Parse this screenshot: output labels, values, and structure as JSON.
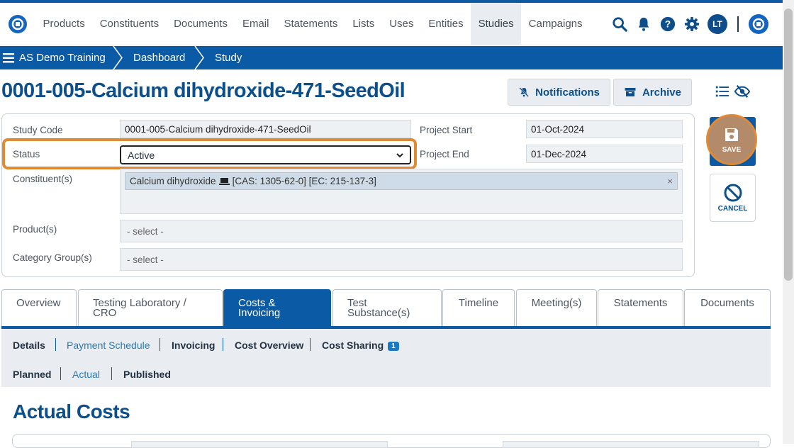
{
  "nav": {
    "items": [
      "Products",
      "Constituents",
      "Documents",
      "Email",
      "Statements",
      "Lists",
      "Uses",
      "Entities",
      "Studies",
      "Campaigns"
    ],
    "active": "Studies",
    "avatar_initials": "LT"
  },
  "breadcrumb": [
    "AS Demo Training",
    "Dashboard",
    "Study"
  ],
  "page_title": "0001-005-Calcium dihydroxide-471-SeedOil",
  "header_buttons": {
    "notifications": "Notifications",
    "archive": "Archive"
  },
  "form": {
    "study_code_label": "Study Code",
    "study_code_value": "0001-005-Calcium dihydroxide-471-SeedOil",
    "status_label": "Status",
    "status_value": "Active",
    "constituents_label": "Constituent(s)",
    "constituent_name": "Calcium dihydroxide",
    "constituent_ids": "[CAS: 1305-62-0] [EC: 215-137-3]",
    "constituent_remove": "×",
    "products_label": "Product(s)",
    "products_placeholder": "- select -",
    "category_label": "Category Group(s)",
    "category_placeholder": "- select -",
    "project_start_label": "Project Start",
    "project_start_value": "01-Oct-2024",
    "project_end_label": "Project End",
    "project_end_value": "01-Dec-2024"
  },
  "actions": {
    "save": "SAVE",
    "cancel": "CANCEL"
  },
  "tabs": [
    {
      "line1": "Overview",
      "line2": ""
    },
    {
      "line1": "Testing Laboratory /",
      "line2": "CRO"
    },
    {
      "line1": "Costs &",
      "line2": "Invoicing"
    },
    {
      "line1": "Test",
      "line2": "Substance(s)"
    },
    {
      "line1": "Timeline",
      "line2": ""
    },
    {
      "line1": "Meeting(s)",
      "line2": ""
    },
    {
      "line1": "Statements",
      "line2": ""
    },
    {
      "line1": "Documents",
      "line2": ""
    }
  ],
  "active_tab": "Costs & Invoicing",
  "subnav": {
    "details": "Details",
    "payment_schedule": "Payment Schedule",
    "invoicing": "Invoicing",
    "cost_overview": "Cost Overview",
    "cost_sharing": "Cost Sharing",
    "cost_sharing_badge": "1",
    "planned": "Planned",
    "actual": "Actual",
    "published": "Published"
  },
  "section_title": "Actual Costs",
  "colors": {
    "primary": "#0b5aa6",
    "title": "#0d4f8b",
    "highlight": "#e08a34"
  }
}
